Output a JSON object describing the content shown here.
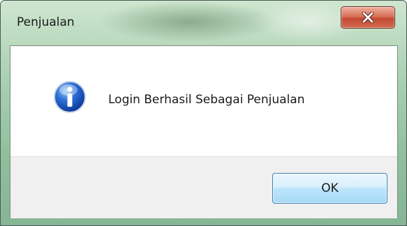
{
  "window": {
    "title": "Penjualan"
  },
  "dialog": {
    "icon": "info-icon",
    "message": "Login Berhasil Sebagai Penjualan",
    "ok_label": "OK"
  },
  "colors": {
    "frame": "#a9d0b2",
    "close_button": "#c24a32",
    "ok_button_border": "#3c7fb1",
    "button_strip": "#f0f0f0"
  }
}
